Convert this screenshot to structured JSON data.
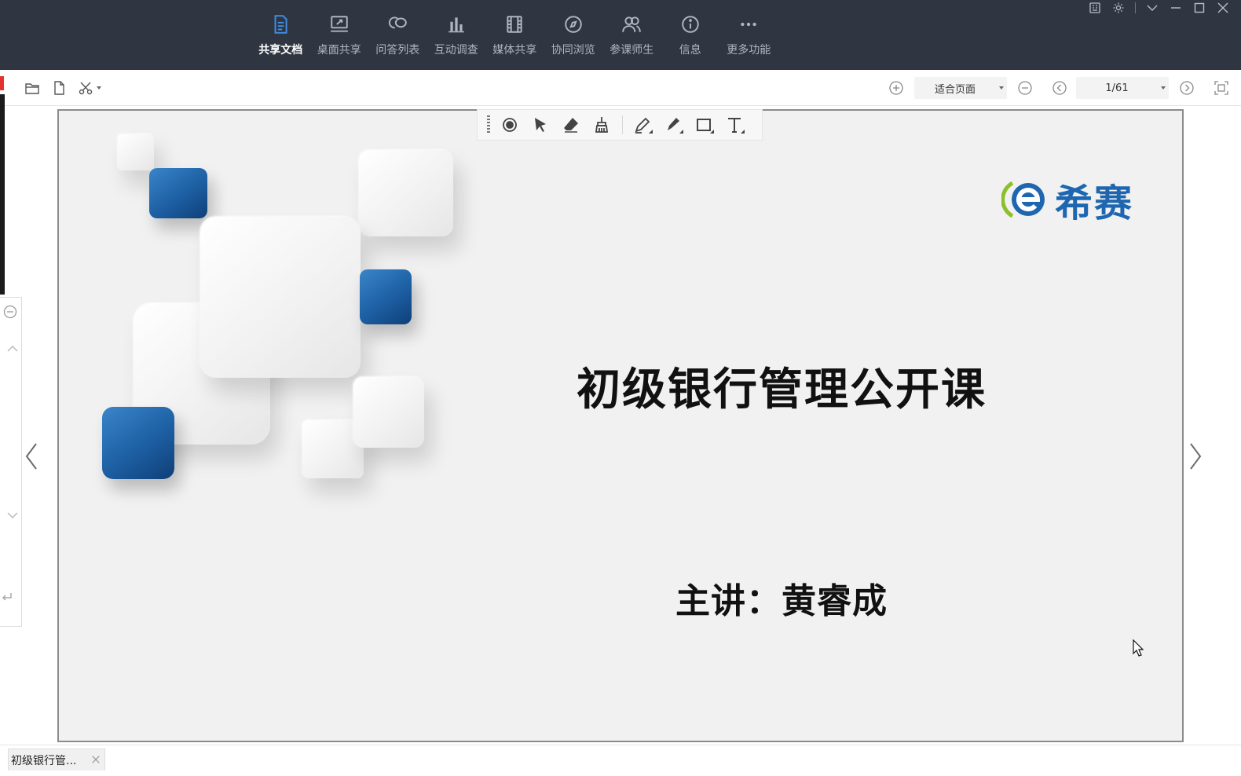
{
  "toolbar_tabs": [
    {
      "label": "共享文档",
      "icon": "document-icon",
      "active": true
    },
    {
      "label": "桌面共享",
      "icon": "desktop-share-icon",
      "active": false
    },
    {
      "label": "问答列表",
      "icon": "chat-bubbles-icon",
      "active": false
    },
    {
      "label": "互动调查",
      "icon": "bar-chart-icon",
      "active": false
    },
    {
      "label": "媒体共享",
      "icon": "film-icon",
      "active": false
    },
    {
      "label": "协同浏览",
      "icon": "compass-icon",
      "active": false
    },
    {
      "label": "参课师生",
      "icon": "people-icon",
      "active": false
    },
    {
      "label": "信息",
      "icon": "info-icon",
      "active": false
    },
    {
      "label": "更多功能",
      "icon": "more-dots-icon",
      "active": false
    }
  ],
  "window_controls": [
    "grid-icon",
    "settings-icon",
    "chevron-down-icon",
    "minimize-icon",
    "maximize-icon",
    "close-icon"
  ],
  "doc_toolbar": {
    "left_icons": [
      "open-folder-icon",
      "file-icon",
      "scissors-icon"
    ],
    "zoom_mode": "适合页面",
    "page_indicator": "1/61"
  },
  "annotation_tools": [
    "record-dot-icon",
    "pointer-arrow-icon",
    "eraser-icon",
    "clear-brush-icon",
    "pen-icon",
    "highlighter-icon",
    "rectangle-icon",
    "text-tool-icon"
  ],
  "slide": {
    "logo_text": "希赛",
    "title": "初级银行管理公开课",
    "speaker": "主讲：黄睿成"
  },
  "doc_tab": {
    "label": "初级银行管...",
    "close_symbol": "×"
  },
  "colors": {
    "topbar_bg": "#2f3641",
    "active_tab": "#ffffff",
    "inactive_tab": "#aeb6c2",
    "tile_blue": "#1d5fa3",
    "logo_blue": "#1e67b0",
    "logo_green": "#8dbf2c",
    "slide_bg": "#f1f1f1"
  }
}
